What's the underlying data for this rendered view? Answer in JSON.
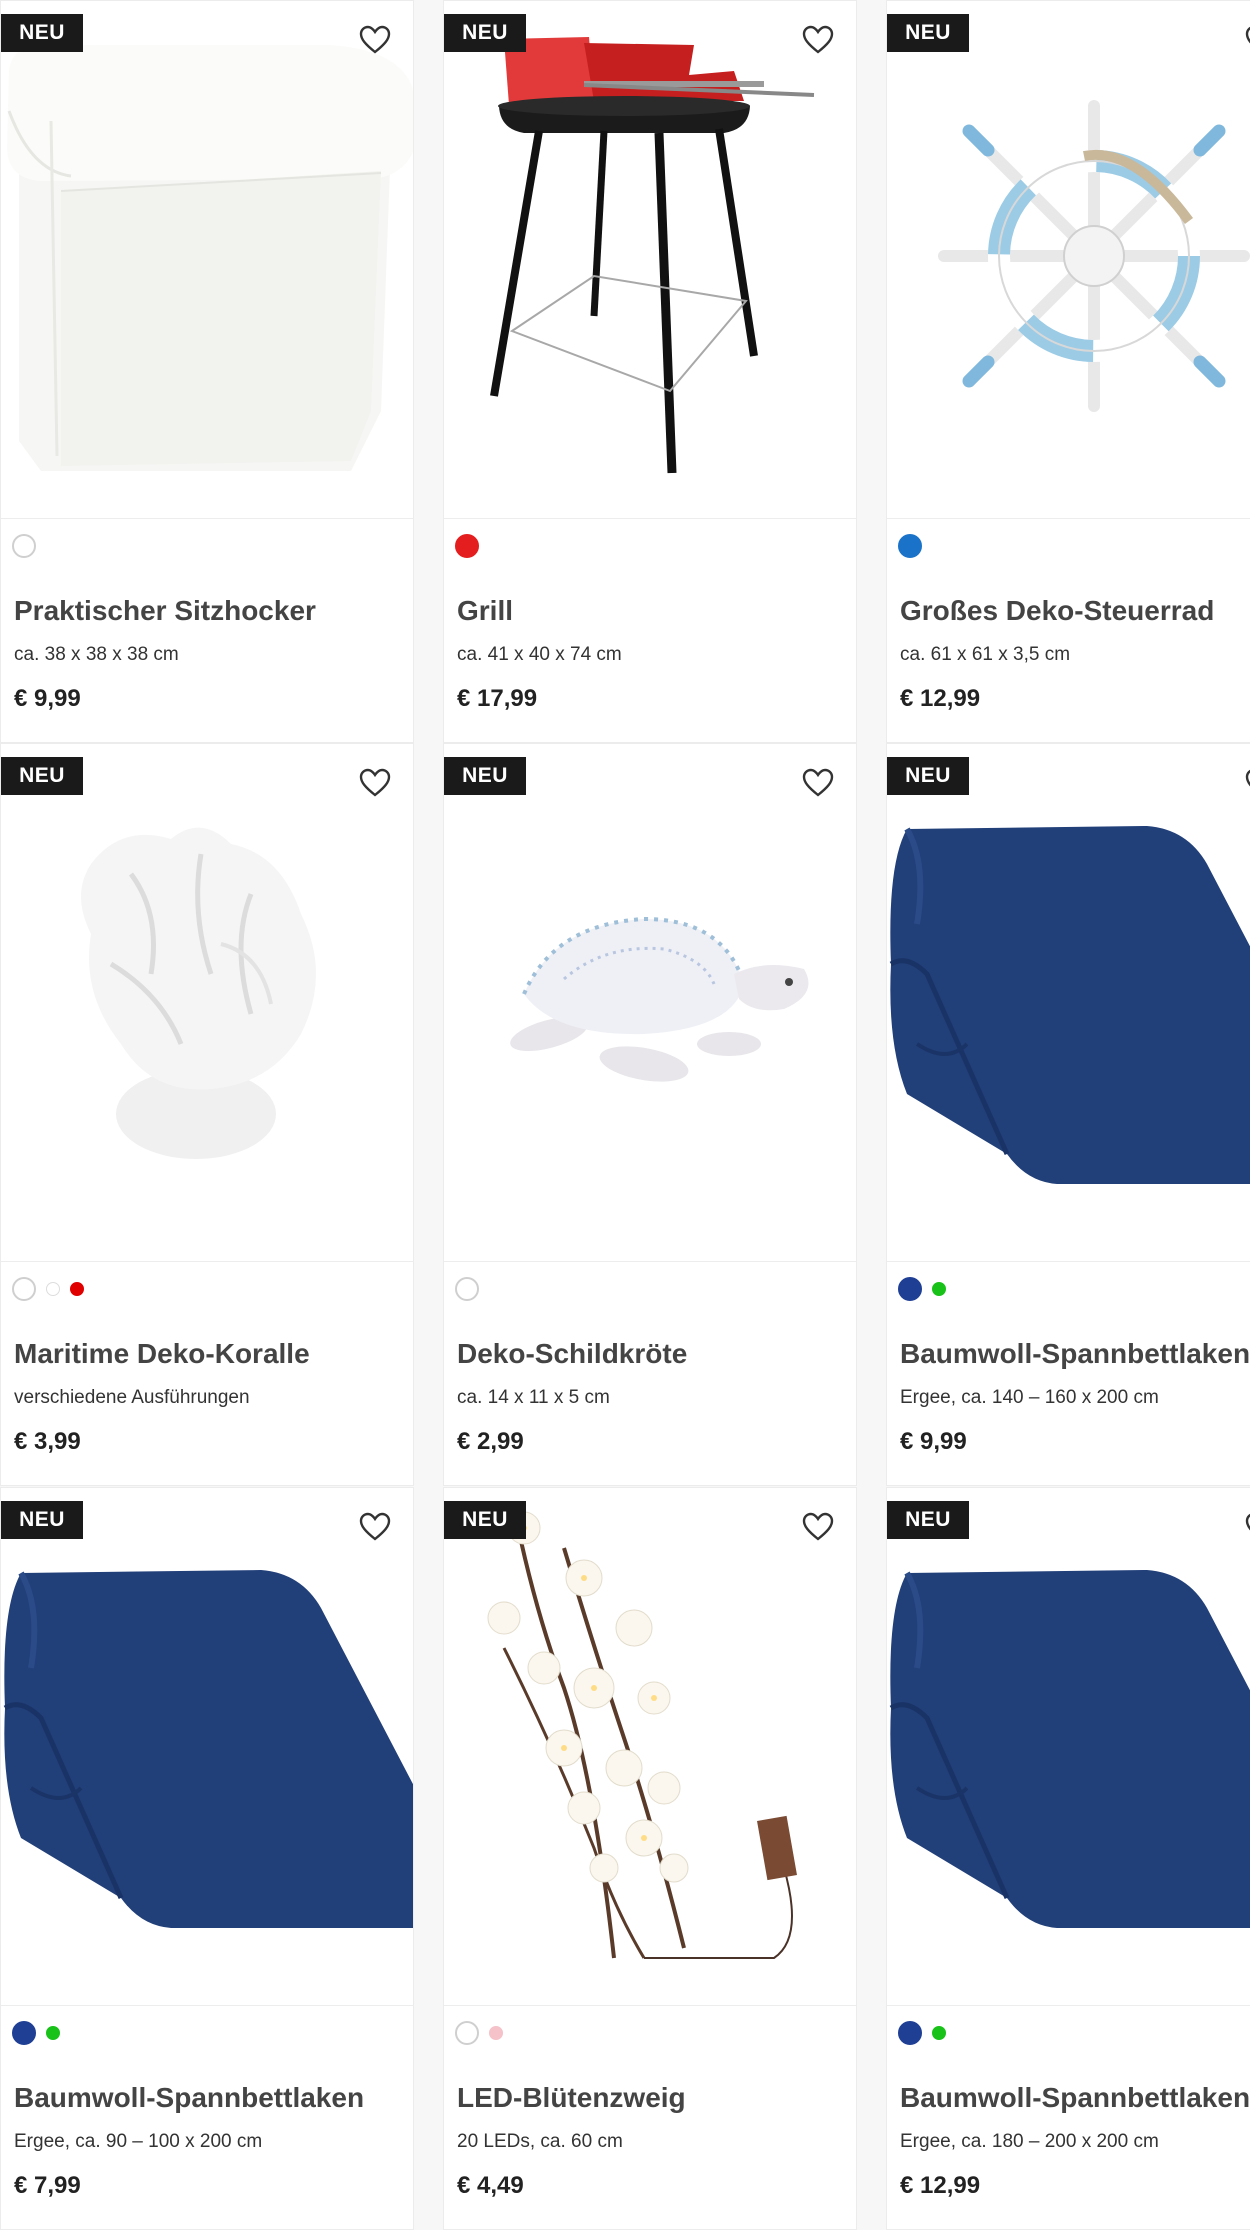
{
  "products": [
    {
      "badge": "NEU",
      "title": "Praktischer Sitzhocker",
      "desc": "ca. 38 x 38 x 38 cm",
      "price": "€ 9,99",
      "image": "stool",
      "swatches": [
        "#ffffff"
      ]
    },
    {
      "badge": "NEU",
      "title": "Grill",
      "desc": "ca. 41 x 40 x 74 cm",
      "price": "€ 17,99",
      "image": "grill",
      "swatches": [
        "#e41e1e"
      ]
    },
    {
      "badge": "NEU",
      "title": "Großes Deko-Steuerrad",
      "desc": "ca. 61 x 61 x 3,5 cm",
      "price": "€ 12,99",
      "image": "wheel",
      "swatches": [
        "#1a73c9"
      ]
    },
    {
      "badge": "NEU",
      "title": "Maritime Deko-Koralle",
      "desc": "verschiedene Ausführungen",
      "price": "€ 3,99",
      "image": "coral",
      "swatches": [
        "#ffffff",
        "#ffffff",
        "#e00000"
      ]
    },
    {
      "badge": "NEU",
      "title": "Deko-Schildkröte",
      "desc": "ca. 14 x 11 x 5 cm",
      "price": "€ 2,99",
      "image": "turtle",
      "swatches": [
        "#ffffff"
      ]
    },
    {
      "badge": "NEU",
      "title": "Baumwoll-Spannbettlaken",
      "desc": "Ergee, ca. 140 – 160 x 200 cm",
      "price": "€ 9,99",
      "image": "sheet",
      "swatches": [
        "#1f3f95",
        "#19c219"
      ]
    },
    {
      "badge": "NEU",
      "title": "Baumwoll-Spannbettlaken",
      "desc": "Ergee, ca. 90 – 100 x 200 cm",
      "price": "€ 7,99",
      "image": "sheet",
      "swatches": [
        "#1f3f95",
        "#19c219"
      ]
    },
    {
      "badge": "NEU",
      "title": "LED-Blütenzweig",
      "desc": "20 LEDs, ca. 60 cm",
      "price": "€ 4,49",
      "image": "branch",
      "swatches": [
        "#ffffff",
        "#f4c2c8"
      ]
    },
    {
      "badge": "NEU",
      "title": "Baumwoll-Spannbettlaken",
      "desc": "Ergee, ca. 180 – 200 x 200 cm",
      "price": "€ 12,99",
      "image": "sheet",
      "swatches": [
        "#1f3f95",
        "#19c219"
      ]
    }
  ]
}
